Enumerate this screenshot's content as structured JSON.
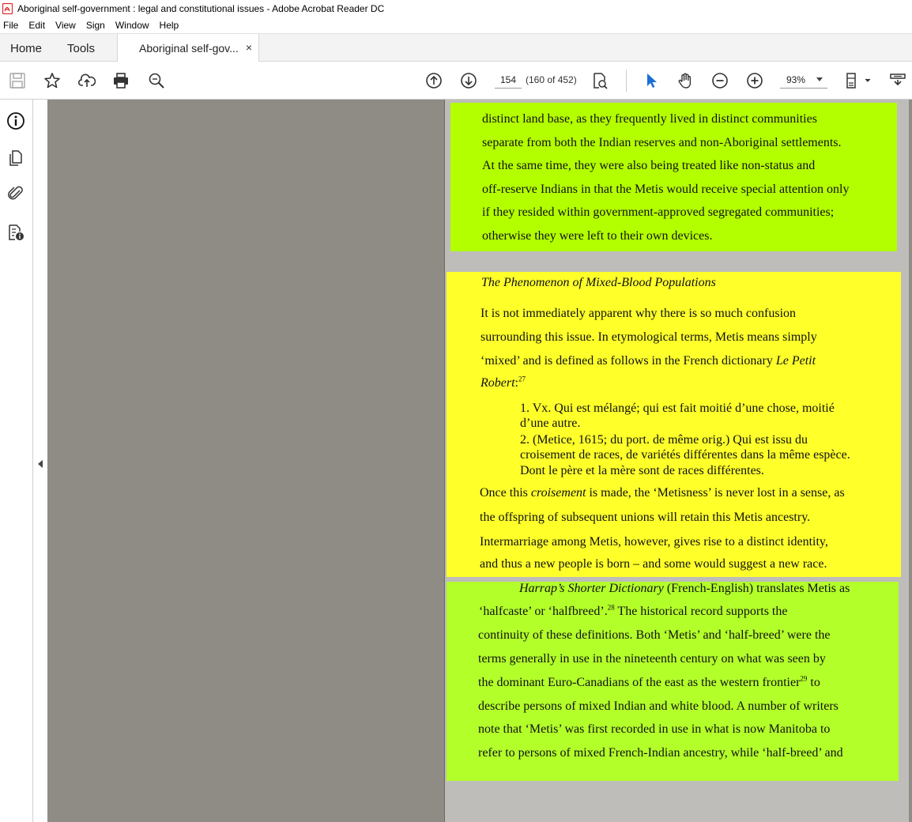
{
  "window": {
    "title": "Aboriginal self-government : legal and constitutional issues - Adobe Acrobat Reader DC"
  },
  "menu": [
    "File",
    "Edit",
    "View",
    "Sign",
    "Window",
    "Help"
  ],
  "tabs": {
    "home": "Home",
    "tools": "Tools",
    "document": "Aboriginal self-gov...",
    "close": "×"
  },
  "toolbar": {
    "page_number": "154",
    "page_count": "(160 of 452)",
    "zoom": "93%",
    "icons": [
      "save-icon",
      "bookmark-star-icon",
      "upload-icon",
      "print-icon",
      "zoom-search-icon",
      "page-up-icon",
      "page-down-icon",
      "find-in-page-icon",
      "select-cursor-icon",
      "hand-tool-icon",
      "zoom-out-icon",
      "zoom-in-icon",
      "page-fit-icon",
      "scrolling-mode-icon"
    ]
  },
  "rail": {
    "icons": [
      "info-icon",
      "pages-icon",
      "attachment-icon",
      "document-properties-icon"
    ]
  },
  "colors": {
    "highlight_green": "#b3ff00",
    "highlight_yellow": "#ffff2a",
    "viewer_bg": "#8f8c85"
  },
  "document": {
    "block1": [
      "distinct land base, as they frequently lived in distinct communities",
      "separate from both the Indian reserves and non-Aboriginal settlements.",
      "At the same time, they were also being treated like non-status and",
      "off-reserve Indians in that the Metis would receive special attention only",
      "if they resided within government-approved segregated communities;",
      "otherwise they were left to their own devices."
    ],
    "heading": "The Phenomenon of Mixed-Blood Populations",
    "block2": {
      "l1": "It is not immediately apparent why there is so much confusion",
      "l2": "surrounding this issue. In etymological terms, Metis means simply",
      "l3a": "‘mixed’ and is defined as follows in the French dictionary ",
      "l3b": "Le Petit",
      "l4a": "Robert",
      "l4b": ":",
      "l4sup": "27",
      "q1": "1. Vx. Qui est mélangé; qui est fait moitié d’une chose, moitié",
      "q2": "d’une autre.",
      "q3": "2. (Metice, 1615; du port. de même orig.) Qui est issu du",
      "q4": "croisement de races, de variétés différentes dans la même espèce.",
      "q5": "Dont le père et la mère sont de races différentes.",
      "l5a": "Once this ",
      "l5b": "croisement",
      "l5c": " is made, the ‘Metisness’ is never lost in a sense, as",
      "l6": "the offspring of subsequent unions will retain this Metis ancestry.",
      "l7": "Intermarriage among Metis, however, gives rise to a distinct identity,",
      "l8": "and thus a new people is born – and some would suggest a new race."
    },
    "block3": {
      "l1a": "Harrap’s Shorter Dictionary",
      "l1b": " (French-English) translates Metis as",
      "l2a": "‘halfcaste’ or ‘halfbreed’.",
      "l2sup": "28",
      "l2b": " The historical record supports the",
      "l3": "continuity of these definitions. Both ‘Metis’ and ‘half-breed’ were the",
      "l4": "terms generally in use in the nineteenth century on what was seen by",
      "l5a": "the dominant Euro-Canadians of the east as the western frontier",
      "l5sup": "29",
      "l5b": " to",
      "l6": "describe persons of mixed Indian and white blood. A number of writers",
      "l7": "note that ‘Metis’ was first recorded in use in what is now Manitoba to",
      "l8": "refer to persons of mixed French-Indian ancestry, while ‘half-breed’ and"
    }
  }
}
